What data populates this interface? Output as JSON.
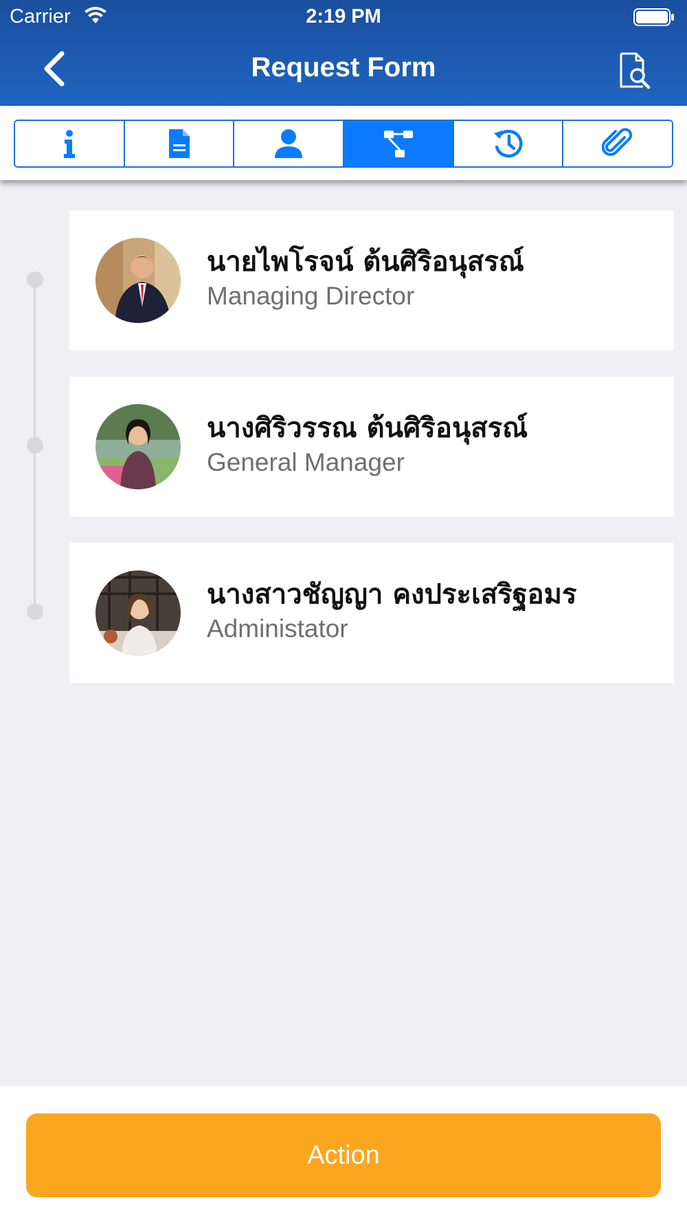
{
  "status_bar": {
    "carrier": "Carrier",
    "time": "2:19 PM"
  },
  "header": {
    "title": "Request Form"
  },
  "tabs": [
    {
      "icon": "info-icon",
      "active": false
    },
    {
      "icon": "document-icon",
      "active": false
    },
    {
      "icon": "user-icon",
      "active": false
    },
    {
      "icon": "workflow-icon",
      "active": true
    },
    {
      "icon": "history-icon",
      "active": false
    },
    {
      "icon": "paperclip-icon",
      "active": false
    }
  ],
  "approvers": [
    {
      "name": "นายไพโรจน์ ต้นศิริอนุสรณ์",
      "role": "Managing Director"
    },
    {
      "name": "นางศิริวรรณ  ต้นศิริอนุสรณ์",
      "role": "General Manager"
    },
    {
      "name": "นางสาวชัญญา คงประเสริฐอมร",
      "role": "Administator"
    }
  ],
  "action_button": {
    "label": "Action"
  },
  "colors": {
    "header": "#1f64c0",
    "active_tab": "#0a7bff",
    "action": "#faa61f",
    "background": "#efeff4"
  }
}
